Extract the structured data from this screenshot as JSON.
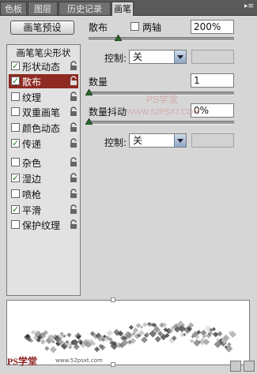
{
  "tabs": [
    {
      "label": "色板",
      "active": false
    },
    {
      "label": "图层",
      "active": false
    },
    {
      "label": "历史记录",
      "active": false
    },
    {
      "label": "画笔",
      "active": true
    }
  ],
  "preset_button": "画笔预设",
  "list": {
    "header": "画笔笔尖形状",
    "items": [
      {
        "label": "形状动态",
        "checked": true,
        "selected": false
      },
      {
        "label": "散布",
        "checked": true,
        "selected": true
      },
      {
        "label": "纹理",
        "checked": false,
        "selected": false
      },
      {
        "label": "双重画笔",
        "checked": false,
        "selected": false
      },
      {
        "label": "颜色动态",
        "checked": false,
        "selected": false
      },
      {
        "label": "传递",
        "checked": true,
        "selected": false
      },
      {
        "label": "杂色",
        "checked": false,
        "selected": false
      },
      {
        "label": "湿边",
        "checked": true,
        "selected": false
      },
      {
        "label": "喷枪",
        "checked": false,
        "selected": false
      },
      {
        "label": "平滑",
        "checked": true,
        "selected": false
      },
      {
        "label": "保护纹理",
        "checked": false,
        "selected": false
      }
    ]
  },
  "scatter": {
    "label": "散布",
    "both_axes_label": "两轴",
    "both_axes_checked": false,
    "value": "200%",
    "slider_fraction": 0.2
  },
  "control1": {
    "label": "控制:",
    "value": "关"
  },
  "count": {
    "label": "数量",
    "value": "1",
    "slider_fraction": 0.0
  },
  "count_jitter": {
    "label": "数量抖动",
    "value": "0%",
    "slider_fraction": 0.0
  },
  "control2": {
    "label": "控制:",
    "value": "关"
  },
  "watermark": {
    "top": "PS学堂",
    "bottom": "WWW.52PSXT.COM"
  },
  "footer": {
    "logo": "PS学堂",
    "url": "www.52psxt.com"
  }
}
